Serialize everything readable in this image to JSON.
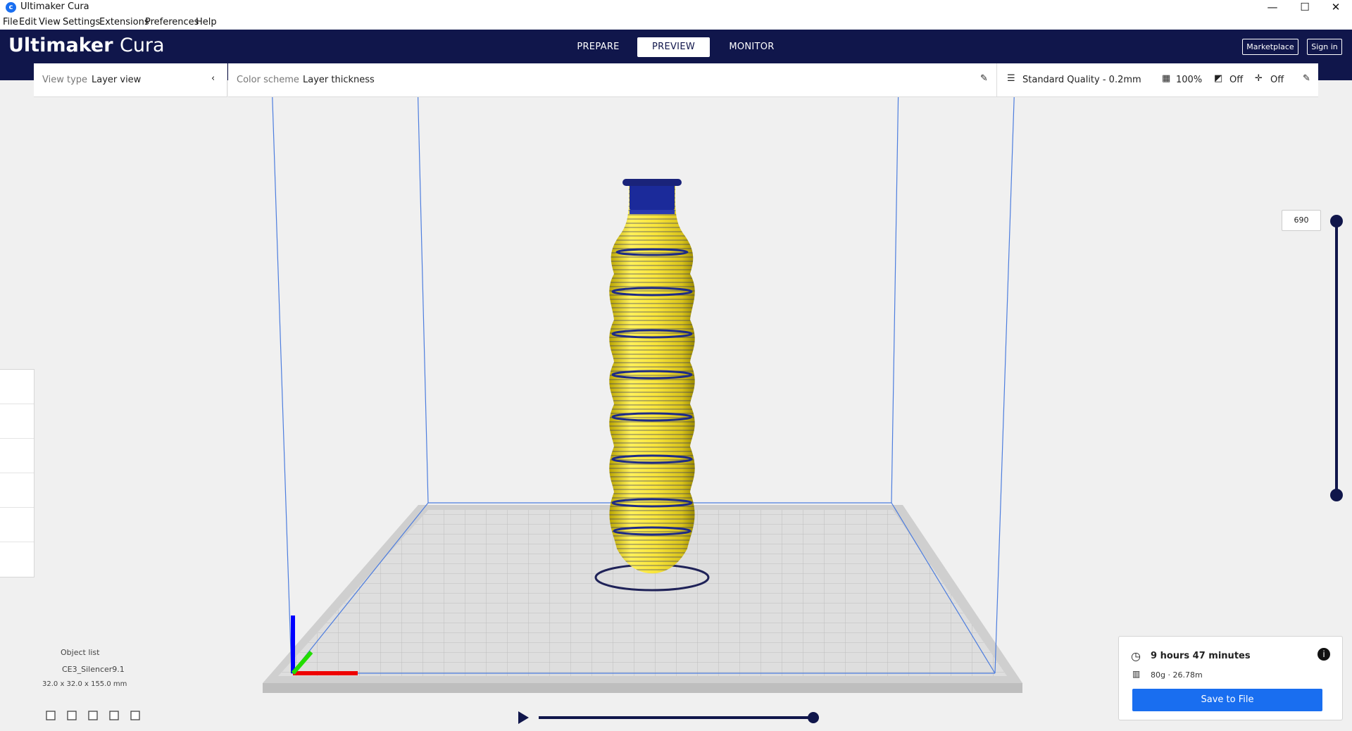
{
  "window": {
    "title": "Ultimaker Cura",
    "min": "—",
    "max": "☐",
    "close": "✕"
  },
  "menu": [
    "File",
    "Edit",
    "View",
    "Settings",
    "Extensions",
    "Preferences",
    "Help"
  ],
  "header": {
    "brand_bold": "Ultimaker",
    "brand_light": "Cura",
    "tabs": [
      "PREPARE",
      "PREVIEW",
      "MONITOR"
    ],
    "active_tab": "PREVIEW",
    "marketplace": "Marketplace",
    "signin": "Sign in"
  },
  "view_panel": {
    "label": "View type",
    "value": "Layer view"
  },
  "color_panel": {
    "label": "Color scheme",
    "value": "Layer thickness"
  },
  "print_setup": {
    "profile": "Standard Quality - 0.2mm",
    "infill": "100%",
    "support": "Off",
    "adhesion": "Off"
  },
  "layer_slider": {
    "current_layer": "690",
    "fraction": 1.0
  },
  "sim_slider": {
    "fraction": 1.0
  },
  "object_list": {
    "header": "Object list",
    "name": "CE3_Silencer9.1",
    "dims": "32.0 x 32.0 x 155.0 mm"
  },
  "print_info": {
    "time": "9 hours 47 minutes",
    "material": "80g · 26.78m",
    "save": "Save to File"
  },
  "icons": [
    "clock-icon",
    "info-icon",
    "filament-icon",
    "pencil-icon",
    "play-icon"
  ]
}
